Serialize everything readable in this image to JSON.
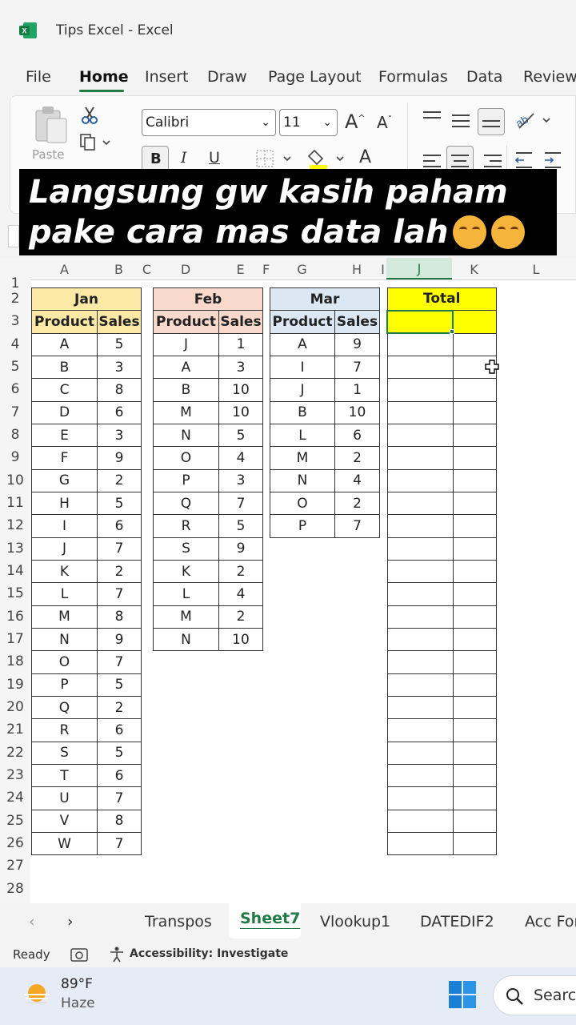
{
  "window": {
    "title": "Tips Excel  -  Excel"
  },
  "menu": [
    "File",
    "Home",
    "Insert",
    "Draw",
    "Page Layout",
    "Formulas",
    "Data",
    "Review"
  ],
  "ribbon": {
    "paste_label": "Paste",
    "font_name": "Calibri",
    "font_size": "11",
    "bold": "B",
    "italic": "I",
    "underline": "U",
    "grow_font": "A",
    "shrink_font": "A",
    "font_color": "A"
  },
  "overlay": {
    "line1": "Langsung gw kasih paham",
    "line2": "pake cara mas data lah"
  },
  "columns": [
    "A",
    "B",
    "C",
    "D",
    "E",
    "F",
    "G",
    "H",
    "I",
    "J",
    "K",
    "L"
  ],
  "rows": [
    "1",
    "2",
    "3",
    "4",
    "5",
    "6",
    "7",
    "8",
    "9",
    "10",
    "11",
    "12",
    "13",
    "14",
    "15",
    "16",
    "17",
    "18",
    "19",
    "20",
    "21",
    "22",
    "23",
    "24",
    "25",
    "26",
    "27",
    "28"
  ],
  "tables": {
    "jan": {
      "title": "Jan",
      "headers": [
        "Product",
        "Sales"
      ],
      "rows": [
        [
          "A",
          "5"
        ],
        [
          "B",
          "3"
        ],
        [
          "C",
          "8"
        ],
        [
          "D",
          "6"
        ],
        [
          "E",
          "3"
        ],
        [
          "F",
          "9"
        ],
        [
          "G",
          "2"
        ],
        [
          "H",
          "5"
        ],
        [
          "I",
          "6"
        ],
        [
          "J",
          "7"
        ],
        [
          "K",
          "2"
        ],
        [
          "L",
          "7"
        ],
        [
          "M",
          "8"
        ],
        [
          "N",
          "9"
        ],
        [
          "O",
          "7"
        ],
        [
          "P",
          "5"
        ],
        [
          "Q",
          "2"
        ],
        [
          "R",
          "6"
        ],
        [
          "S",
          "5"
        ],
        [
          "T",
          "6"
        ],
        [
          "U",
          "7"
        ],
        [
          "V",
          "8"
        ],
        [
          "W",
          "7"
        ]
      ]
    },
    "feb": {
      "title": "Feb",
      "headers": [
        "Product",
        "Sales"
      ],
      "rows": [
        [
          "J",
          "1"
        ],
        [
          "A",
          "3"
        ],
        [
          "B",
          "10"
        ],
        [
          "M",
          "10"
        ],
        [
          "N",
          "5"
        ],
        [
          "O",
          "4"
        ],
        [
          "P",
          "3"
        ],
        [
          "Q",
          "7"
        ],
        [
          "R",
          "5"
        ],
        [
          "S",
          "9"
        ],
        [
          "K",
          "2"
        ],
        [
          "L",
          "4"
        ],
        [
          "M",
          "2"
        ],
        [
          "N",
          "10"
        ]
      ]
    },
    "mar": {
      "title": "Mar",
      "headers": [
        "Product",
        "Sales"
      ],
      "rows": [
        [
          "A",
          "9"
        ],
        [
          "I",
          "7"
        ],
        [
          "J",
          "1"
        ],
        [
          "B",
          "10"
        ],
        [
          "L",
          "6"
        ],
        [
          "M",
          "2"
        ],
        [
          "N",
          "4"
        ],
        [
          "O",
          "2"
        ],
        [
          "P",
          "7"
        ]
      ]
    },
    "total": {
      "title": "Total"
    }
  },
  "sheet_tabs": [
    "Transpos",
    "Sheet7",
    "Vlookup1",
    "DATEDIF2",
    "Acc For"
  ],
  "active_tab": "Sheet7",
  "status": {
    "ready": "Ready",
    "accessibility": "Accessibility: Investigate"
  },
  "taskbar": {
    "temp": "89°F",
    "weather": "Haze",
    "search": "Search"
  },
  "colors": {
    "jan_header": "#fde9a6",
    "feb_header": "#f8d9cc",
    "mar_header": "#dbe8f3",
    "total_header": "#ffff00",
    "excel_green": "#1f7a45"
  }
}
